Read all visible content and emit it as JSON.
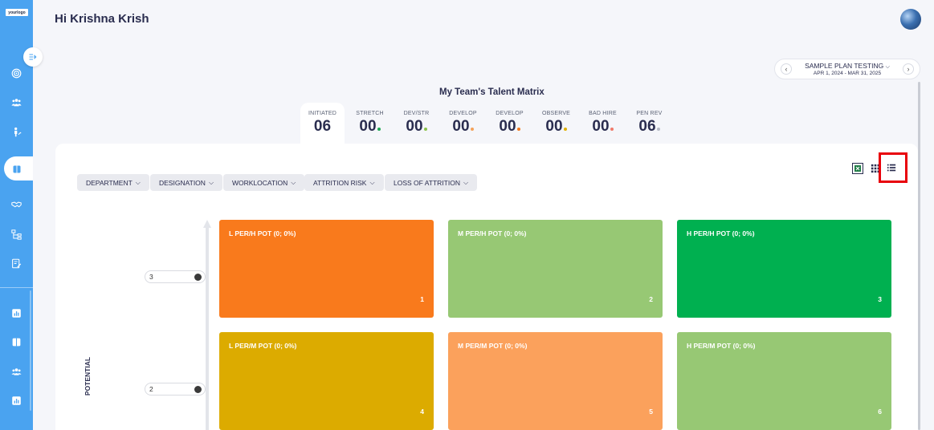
{
  "sidebar": {
    "logo_text": "yourlogo",
    "icons": [
      "target-icon",
      "team-icon",
      "person-growth-icon",
      "book-icon",
      "handshake-icon",
      "org-chart-icon",
      "edit-doc-icon",
      "bar-chart-icon",
      "book-open-icon",
      "group-icon",
      "report-icon"
    ]
  },
  "header": {
    "greeting": "Hi Krishna Krish"
  },
  "plan": {
    "name": "SAMPLE PLAN TESTING",
    "dates": "APR 1, 2024 - MAR 31, 2025",
    "prev_icon": "‹",
    "next_icon": "›",
    "dropdown_icon": "⌵"
  },
  "matrix": {
    "title": "My Team's Talent Matrix",
    "stats": [
      {
        "label": "INITIATED",
        "value": "06",
        "dot": ""
      },
      {
        "label": "STRETCH",
        "value": "00",
        "dot": "#1fa855"
      },
      {
        "label": "DEV/STR",
        "value": "00",
        "dot": "#8bc34a"
      },
      {
        "label": "DEVELOP",
        "value": "00",
        "dot": "#f4a259"
      },
      {
        "label": "DEVELOP",
        "value": "00",
        "dot": "#f47c20"
      },
      {
        "label": "OBSERVE",
        "value": "00",
        "dot": "#e0b000"
      },
      {
        "label": "BAD HIRE",
        "value": "00",
        "dot": "#f07a6a"
      },
      {
        "label": "PEN REV",
        "value": "06",
        "dot": "#b8bcc6"
      }
    ]
  },
  "filters": [
    "DEPARTMENT",
    "DESIGNATION",
    "WORKLOCATION",
    "ATTRITION RISK",
    "LOSS OF ATTRITION"
  ],
  "grid": {
    "y_axis_label": "POTENTIAL",
    "rows": [
      {
        "level": "3",
        "cells": [
          {
            "label": "L PER/H POT (0; 0%)",
            "number": "1",
            "color": "#f97a1c"
          },
          {
            "label": "M PER/H POT (0; 0%)",
            "number": "2",
            "color": "#97c874"
          },
          {
            "label": "H PER/H POT (0; 0%)",
            "number": "3",
            "color": "#00b050"
          }
        ]
      },
      {
        "level": "2",
        "cells": [
          {
            "label": "L PER/M POT (0; 0%)",
            "number": "4",
            "color": "#dcab00"
          },
          {
            "label": "M PER/M POT (0; 0%)",
            "number": "5",
            "color": "#fba15c"
          },
          {
            "label": "H PER/M POT (0; 0%)",
            "number": "6",
            "color": "#97c874"
          }
        ]
      }
    ]
  },
  "colors": {
    "sidebar": "#4aa3f0",
    "highlight": "#e8000a"
  }
}
